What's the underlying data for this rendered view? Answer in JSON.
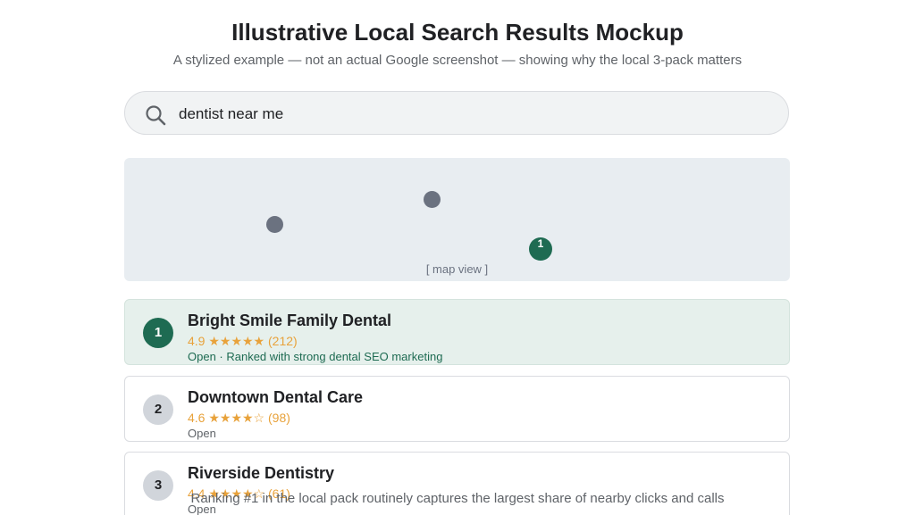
{
  "header": {
    "title": "Illustrative Local Search Results Mockup",
    "subtitle": "A stylized example — not an actual Google screenshot — showing why the local 3-pack matters"
  },
  "search": {
    "icon": "search-icon",
    "query": "dentist near me"
  },
  "map": {
    "label": "[ map view ]",
    "highlighted_pin_label": "1"
  },
  "results": [
    {
      "rank": "1",
      "name": "Bright Smile Family Dental",
      "rating": "4.9 ★★★★★ (212)",
      "status": "Open · Ranked with strong dental SEO marketing"
    },
    {
      "rank": "2",
      "name": "Downtown Dental Care",
      "rating": "4.6 ★★★★☆ (98)",
      "status": "Open"
    },
    {
      "rank": "3",
      "name": "Riverside Dentistry",
      "rating": "4.4 ★★★★☆ (61)",
      "status": "Open"
    }
  ],
  "footnote": "Ranking #1 in the local pack routinely captures the largest share of nearby clicks and calls",
  "colors": {
    "accent": "#1e6b52",
    "star": "#e8a23b",
    "pin": "#6b7280"
  }
}
